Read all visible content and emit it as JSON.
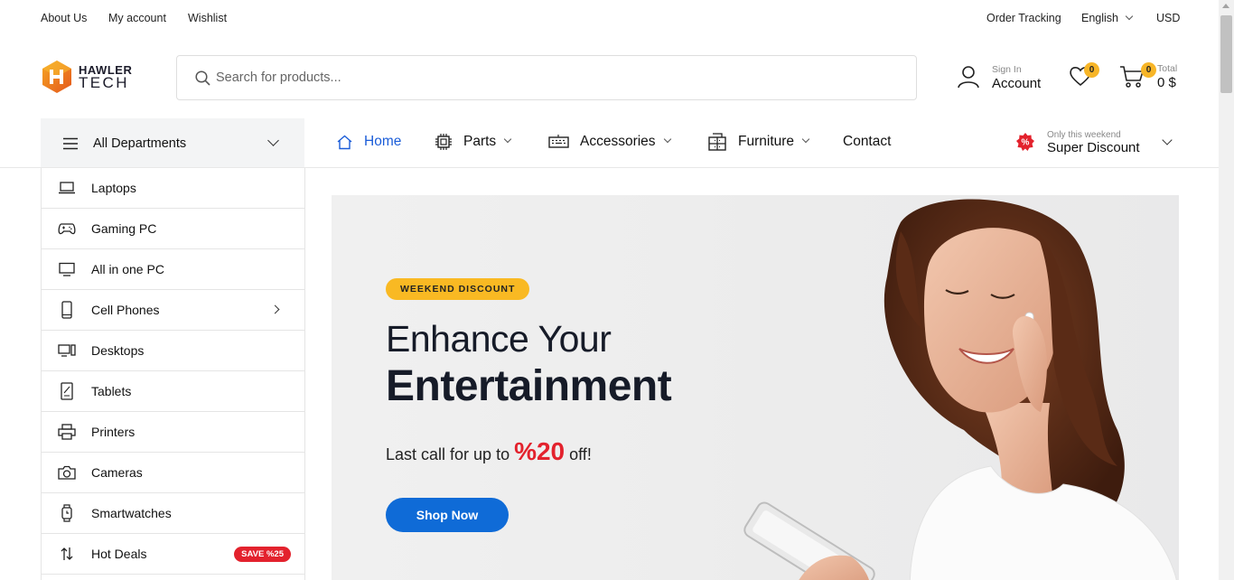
{
  "topbar": {
    "links": [
      "About Us",
      "My account",
      "Wishlist"
    ],
    "order_tracking": "Order Tracking",
    "language": "English",
    "currency": "USD"
  },
  "logo": {
    "line1": "HAWLER",
    "line2": "TECH"
  },
  "search": {
    "placeholder": "Search for products..."
  },
  "account": {
    "small": "Sign In",
    "big": "Account"
  },
  "wishlist": {
    "count": "0"
  },
  "cart": {
    "count": "0",
    "small": "Total",
    "big": "0 $"
  },
  "departments": {
    "label": "All Departments"
  },
  "nav": {
    "home": "Home",
    "parts": "Parts",
    "accessories": "Accessories",
    "furniture": "Furniture",
    "contact": "Contact"
  },
  "discount": {
    "small": "Only this weekend",
    "big": "Super Discount"
  },
  "sidebar": {
    "items": [
      {
        "label": "Laptops",
        "icon": "laptop-icon"
      },
      {
        "label": "Gaming PC",
        "icon": "gamepad-icon"
      },
      {
        "label": "All in one PC",
        "icon": "monitor-icon"
      },
      {
        "label": "Cell Phones",
        "icon": "phone-icon"
      },
      {
        "label": "Desktops",
        "icon": "desktop-icon"
      },
      {
        "label": "Tablets",
        "icon": "tablet-icon"
      },
      {
        "label": "Printers",
        "icon": "printer-icon"
      },
      {
        "label": "Cameras",
        "icon": "camera-icon"
      },
      {
        "label": "Smartwatches",
        "icon": "smartwatch-icon"
      },
      {
        "label": "Hot Deals",
        "icon": "sort-arrows-icon"
      }
    ],
    "hot_deals_badge": "SAVE %25"
  },
  "hero": {
    "tag": "WEEKEND DISCOUNT",
    "title_line1": "Enhance Your",
    "title_line2": "Entertainment",
    "sub_before": "Last call for up to",
    "sub_percent": "%20",
    "sub_after": "off!",
    "button": "Shop Now"
  },
  "colors": {
    "accent_blue": "#0f6bd7",
    "badge_yellow": "#f9b923",
    "sale_red": "#e3222d"
  }
}
